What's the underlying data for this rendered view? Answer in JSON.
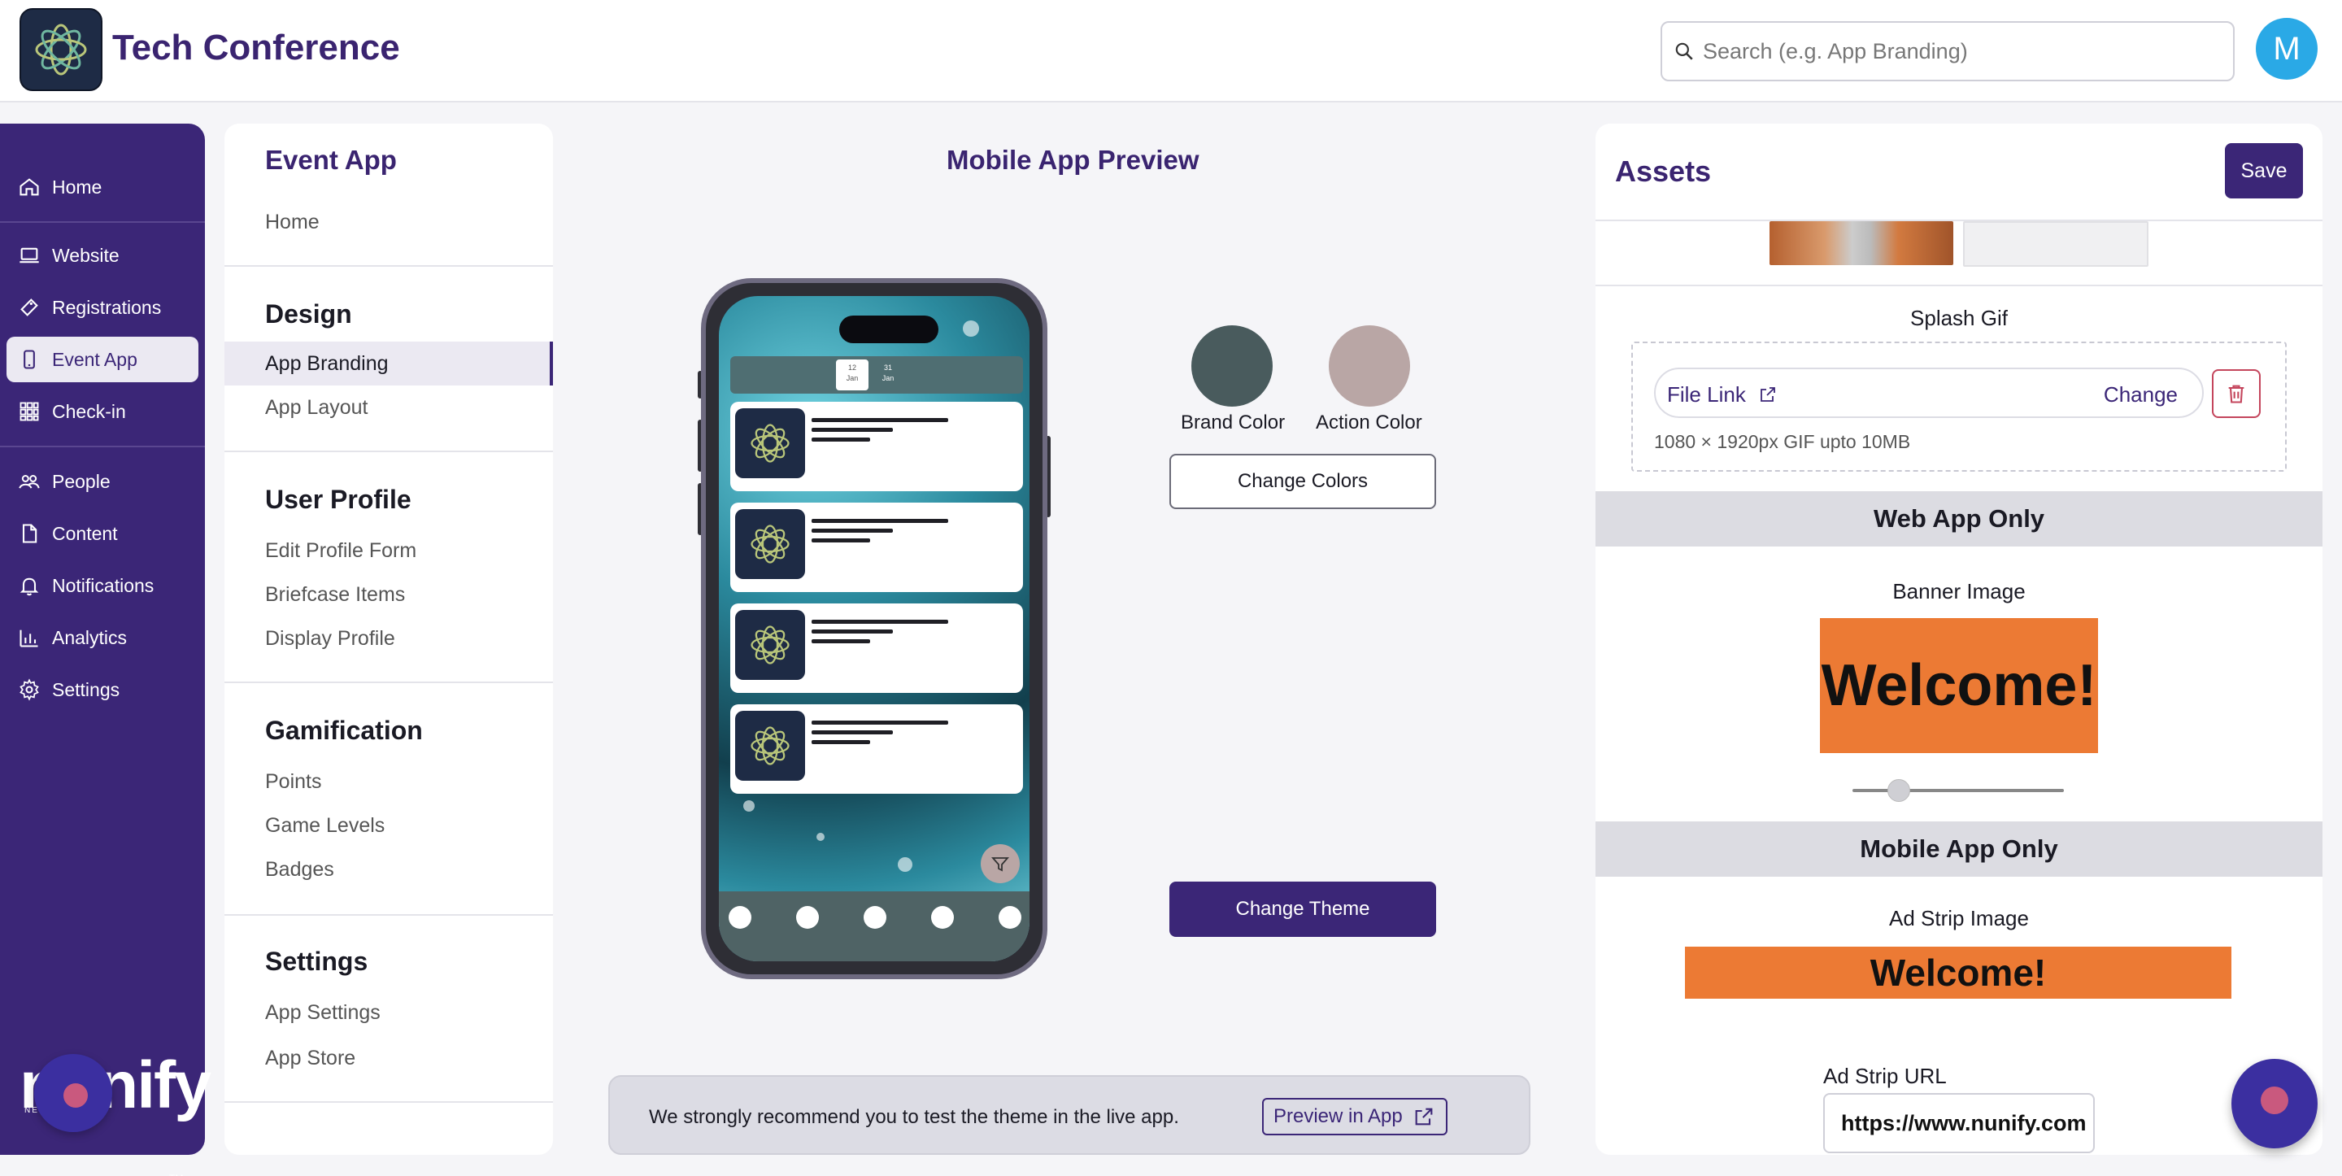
{
  "header": {
    "app_title": "Tech Conference",
    "search_placeholder": "Search (e.g. App Branding)",
    "avatar_initial": "M"
  },
  "leftnav": {
    "items": [
      {
        "label": "Home",
        "icon": "home-icon"
      },
      {
        "label": "Website",
        "icon": "laptop-icon"
      },
      {
        "label": "Registrations",
        "icon": "ticket-icon"
      },
      {
        "label": "Event App",
        "icon": "mobile-icon",
        "active": true
      },
      {
        "label": "Check-in",
        "icon": "qr-icon"
      },
      {
        "label": "People",
        "icon": "people-icon"
      },
      {
        "label": "Content",
        "icon": "document-icon"
      },
      {
        "label": "Notifications",
        "icon": "bell-icon"
      },
      {
        "label": "Analytics",
        "icon": "chart-icon"
      },
      {
        "label": "Settings",
        "icon": "gear-icon"
      }
    ],
    "brand_logo": "nunify",
    "brand_sub": "NETWORK",
    "trademark": "TM"
  },
  "subnav": {
    "title": "Event App",
    "home": "Home",
    "design": {
      "heading": "Design",
      "items": [
        "App Branding",
        "App Layout"
      ]
    },
    "user_profile": {
      "heading": "User Profile",
      "items": [
        "Edit Profile Form",
        "Briefcase Items",
        "Display Profile"
      ]
    },
    "gamification": {
      "heading": "Gamification",
      "items": [
        "Points",
        "Game Levels",
        "Badges"
      ]
    },
    "settings": {
      "heading": "Settings",
      "items": [
        "App Settings",
        "App Store"
      ]
    }
  },
  "preview": {
    "title": "Mobile App Preview",
    "dates": [
      {
        "day": "12",
        "month": "Jan"
      },
      {
        "day": "31",
        "month": "Jan"
      }
    ],
    "brand_color_label": "Brand Color",
    "action_color_label": "Action Color",
    "brand_color": "#495b5d",
    "action_color": "#b9a6a5",
    "change_colors": "Change Colors",
    "change_theme": "Change Theme",
    "notice": "We strongly recommend you to test the theme in the live app.",
    "preview_in_app": "Preview in App"
  },
  "assets": {
    "title": "Assets",
    "save": "Save",
    "splash_label": "Splash Gif",
    "file_link": "File Link",
    "change": "Change",
    "file_hint": "1080 × 1920px GIF upto 10MB",
    "web_only": "Web App Only",
    "banner_label": "Banner Image",
    "banner_text": "Welcome!",
    "banner_slider_value": 0.22,
    "mobile_only": "Mobile App Only",
    "adstrip_label": "Ad Strip Image",
    "adstrip_text": "Welcome!",
    "adstrip_url_label": "Ad Strip URL",
    "adstrip_url": "https://www.nunify.com"
  },
  "colors": {
    "brand": "#3b2677",
    "accent_orange": "#ec7a34"
  }
}
